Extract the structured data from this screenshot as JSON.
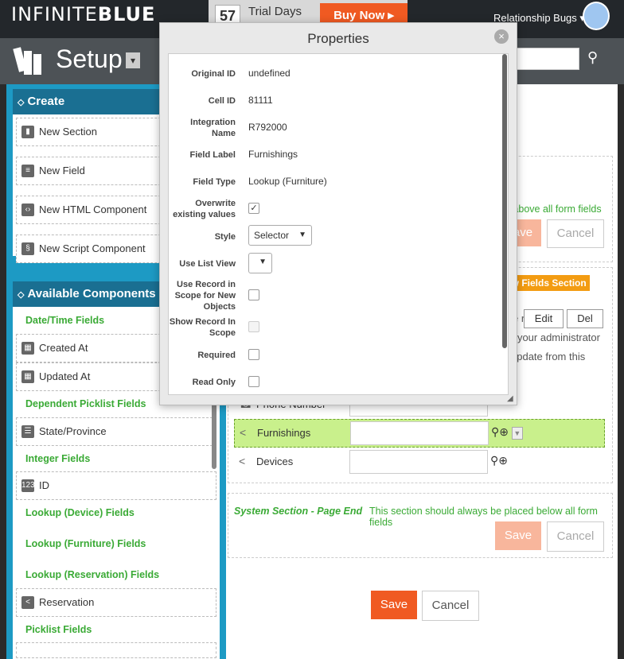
{
  "topbar": {
    "logo_part1": "INFINITE",
    "logo_part2": "BLUE",
    "trial_days_num": "57",
    "trial_days_label": "Trial Days",
    "buy_now": "Buy Now ▸",
    "app_name": "Relationship Bugs ▾"
  },
  "setup": {
    "title": "Setup",
    "dropdown": "▾",
    "search_icon": "🔍"
  },
  "sidebar": {
    "create": {
      "title": "Create",
      "arrow": "◇",
      "items": [
        {
          "label": "New Section",
          "icon": "section-icon"
        },
        {
          "label": "New Field",
          "icon": "field-icon"
        },
        {
          "label": "New HTML Component",
          "icon": "html-icon"
        },
        {
          "label": "New Script Component",
          "icon": "script-icon"
        }
      ]
    },
    "available": {
      "title": "Available Components",
      "arrow": "◇",
      "categories": {
        "datetime": "Date/Time Fields",
        "dependent": "Dependent Picklist Fields",
        "integer": "Integer Fields",
        "lookup_device": "Lookup (Device) Fields",
        "lookup_furniture": "Lookup (Furniture) Fields",
        "lookup_reservation": "Lookup (Reservation) Fields",
        "picklist": "Picklist Fields"
      },
      "items": {
        "created_at": "Created At",
        "updated_at": "Updated At",
        "state_province": "State/Province",
        "id": "ID",
        "reservation": "Reservation"
      }
    }
  },
  "main": {
    "top_hint": "d above all form fields",
    "save": "Save",
    "cancel": "Cancel",
    "new_fields_section": "ew Fields Section",
    "edit": "Edit",
    "del": "Del",
    "admin_text_1": "r your administrator",
    "admin_text_2": "update from this",
    "letter_r": "e r",
    "rows": {
      "phone": "Phone Number",
      "furnishings": "Furnishings",
      "devices": "Devices"
    },
    "system_section_label": "System Section - Page End",
    "system_section_note": "This section should always be placed below all form fields",
    "bottom_save": "Save",
    "bottom_cancel": "Cancel"
  },
  "modal": {
    "title": "Properties",
    "close": "×",
    "props": {
      "original_id_label": "Original ID",
      "original_id": "undefined",
      "cell_id_label": "Cell ID",
      "cell_id": "81111",
      "integration_name_label": "Integration Name",
      "integration_name": "R792000",
      "field_label_label": "Field Label",
      "field_label": "Furnishings",
      "field_type_label": "Field Type",
      "field_type": "Lookup (Furniture)",
      "overwrite_label": "Overwrite existing values",
      "overwrite_checked": true,
      "style_label": "Style",
      "style_value": "Selector",
      "use_list_view_label": "Use List View",
      "use_record_label": "Use Record in Scope for New Objects",
      "show_record_label": "Show Record In Scope",
      "required_label": "Required",
      "read_only_label": "Read Only"
    }
  }
}
